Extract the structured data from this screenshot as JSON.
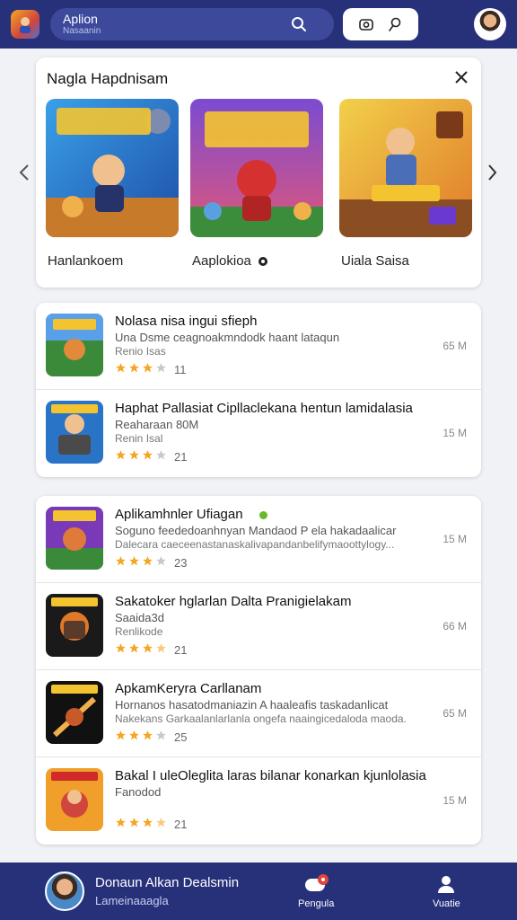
{
  "header": {
    "search_title": "Aplion",
    "search_subtitle": "Nasaanin"
  },
  "featured": {
    "title": "Nagla Hapdnisam",
    "items": [
      {
        "caption": "Hanlankoem"
      },
      {
        "caption": "Aaplokioa"
      },
      {
        "caption": "Uiala Saisa"
      }
    ]
  },
  "list_group_1": [
    {
      "title": "Nolasa nisa ingui sfieph",
      "sub": "Una Dsme ceagnoakmndodk haant lataqun",
      "sub2": "Renio Isas",
      "rating": 3,
      "count": "11",
      "size": "65 M"
    },
    {
      "title": "Haphat Pallasiat Cipllaclekana hentun lamidalasia",
      "sub": "Reaharaan 80M",
      "sub2": "Renin Isal",
      "rating": 3,
      "count": "21",
      "size": "15 M"
    }
  ],
  "list_group_2": [
    {
      "title": "Aplikamhnler Ufiagan",
      "sub": "Soguno feededoanhnyan Mandaod P ela hakadaalicar",
      "sub2": "Dalecara caeceenastanaskalivapandanbelifyma​oottylogy...",
      "rating": 3,
      "count": "23",
      "size": "15 M"
    },
    {
      "title": "Sakatoker hglarlan Dalta Pranigielakam",
      "sub": "Saaida3d",
      "sub2": "Renlikode",
      "rating": 3.5,
      "count": "21",
      "size": "66 M"
    },
    {
      "title": "ApkamKeryra Carllanam",
      "sub": "Hornanos hasatodmaniazin A haaleafis taskadanlicat",
      "sub2": "Nakekans Garkaalanlarlanla ongefa naaingicedaloda maoda.",
      "rating": 3,
      "count": "25",
      "size": "65 M"
    },
    {
      "title": "Bakal I uleOleglita laras bilanar konarkan kjunlolasia",
      "sub": "Fanodod",
      "sub2": "",
      "rating": 3.5,
      "count": "21",
      "size": "15 M"
    }
  ],
  "bottom": {
    "name": "Donaun Alkan Dealsmin",
    "role": "Lameinaaagla",
    "nav_label_1": "Pengula",
    "nav_label_2": "Vuatie"
  },
  "colors": {
    "brand": "#27317a",
    "star": "#f5a623"
  }
}
